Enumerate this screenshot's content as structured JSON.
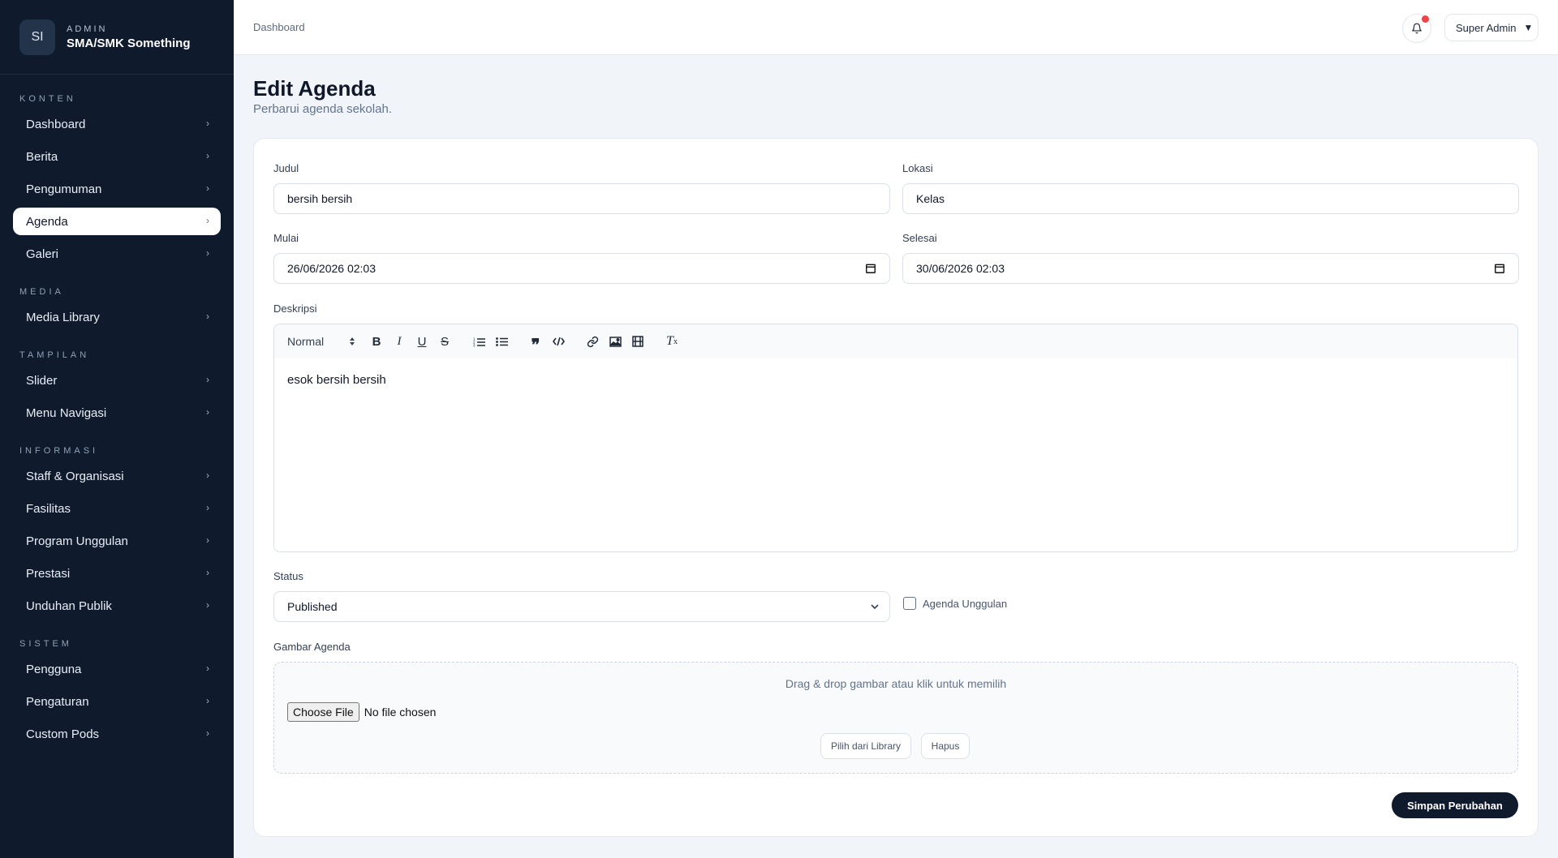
{
  "brand": {
    "logo": "SI",
    "kicker": "ADMIN",
    "name": "SMA/SMK Something"
  },
  "sidebar": {
    "sections": [
      {
        "title": "KONTEN",
        "items": [
          {
            "label": "Dashboard",
            "active": false
          },
          {
            "label": "Berita",
            "active": false
          },
          {
            "label": "Pengumuman",
            "active": false
          },
          {
            "label": "Agenda",
            "active": true
          },
          {
            "label": "Galeri",
            "active": false
          }
        ]
      },
      {
        "title": "MEDIA",
        "items": [
          {
            "label": "Media Library",
            "active": false
          }
        ]
      },
      {
        "title": "TAMPILAN",
        "items": [
          {
            "label": "Slider",
            "active": false
          },
          {
            "label": "Menu Navigasi",
            "active": false
          }
        ]
      },
      {
        "title": "INFORMASI",
        "items": [
          {
            "label": "Staff & Organisasi",
            "active": false
          },
          {
            "label": "Fasilitas",
            "active": false
          },
          {
            "label": "Program Unggulan",
            "active": false
          },
          {
            "label": "Prestasi",
            "active": false
          },
          {
            "label": "Unduhan Publik",
            "active": false
          }
        ]
      },
      {
        "title": "SISTEM",
        "items": [
          {
            "label": "Pengguna",
            "active": false
          },
          {
            "label": "Pengaturan",
            "active": false
          },
          {
            "label": "Custom Pods",
            "active": false
          }
        ]
      }
    ]
  },
  "topbar": {
    "breadcrumb": "Dashboard",
    "user": "Super Admin",
    "notification_dot_color": "#ef4444"
  },
  "page": {
    "title": "Edit Agenda",
    "subtitle": "Perbarui agenda sekolah."
  },
  "form": {
    "judul": {
      "label": "Judul",
      "value": "bersih bersih"
    },
    "lokasi": {
      "label": "Lokasi",
      "value": "Kelas"
    },
    "mulai": {
      "label": "Mulai",
      "value": "26/06/2026 02:03"
    },
    "selesai": {
      "label": "Selesai",
      "value": "30/06/2026 02:03"
    },
    "deskripsi": {
      "label": "Deskripsi",
      "format": "Normal",
      "toolbar_icons": [
        "bold-icon",
        "italic-icon",
        "underline-icon",
        "strike-icon",
        "ordered-list-icon",
        "bullet-list-icon",
        "blockquote-icon",
        "code-icon",
        "link-icon",
        "image-icon",
        "video-icon",
        "clean-format-icon"
      ],
      "content": "esok bersih bersih"
    },
    "status": {
      "label": "Status",
      "value": "Published"
    },
    "featured": {
      "label": "Agenda Unggulan",
      "checked": false
    },
    "gambar": {
      "label": "Gambar Agenda",
      "hint": "Drag & drop gambar atau klik untuk memilih",
      "choose_label": "Choose File",
      "file_status": "No file chosen",
      "library_label": "Pilih dari Library",
      "remove_label": "Hapus"
    },
    "save_label": "Simpan Perubahan"
  },
  "colors": {
    "sidebar_bg": "#0f1b2d",
    "page_bg": "#f1f4f8",
    "primary_button": "#0f1b2d"
  }
}
